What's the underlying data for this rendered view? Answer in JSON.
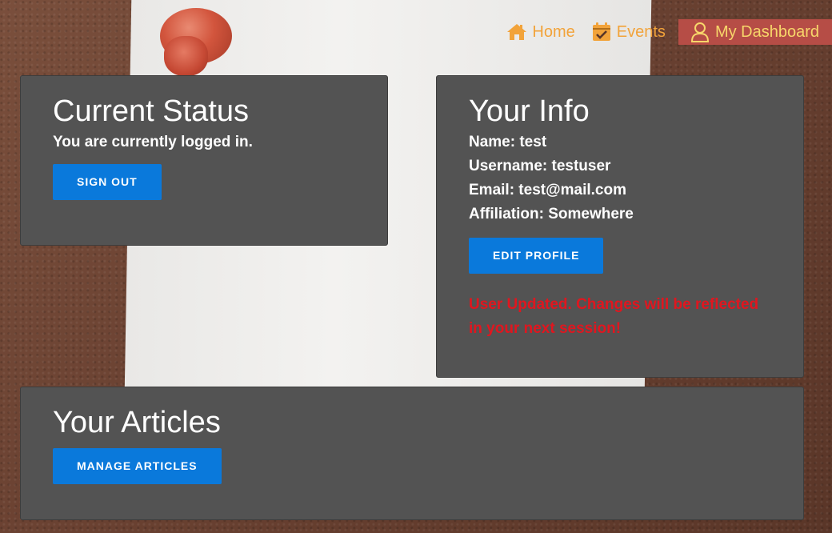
{
  "nav": {
    "home_label": "Home",
    "events_label": "Events",
    "dashboard_label": "My Dashboard"
  },
  "status": {
    "title": "Current Status",
    "message": "You are currently logged in.",
    "sign_out_label": "SIGN OUT"
  },
  "info": {
    "title": "Your Info",
    "name": "Name: test",
    "username": "Username: testuser",
    "email": "Email: test@mail.com",
    "affiliation": "Affiliation: Somewhere",
    "edit_label": "EDIT PROFILE",
    "update_message": "User Updated. Changes will be reflected in your next session!"
  },
  "articles": {
    "title": "Your Articles",
    "manage_label": "MANAGE ARTICLES"
  },
  "colors": {
    "nav_text": "#f2a33a",
    "nav_active_bg": "#b64d46",
    "card_bg": "#535353",
    "button_bg": "#0a79db",
    "error_text": "#e0161f"
  }
}
